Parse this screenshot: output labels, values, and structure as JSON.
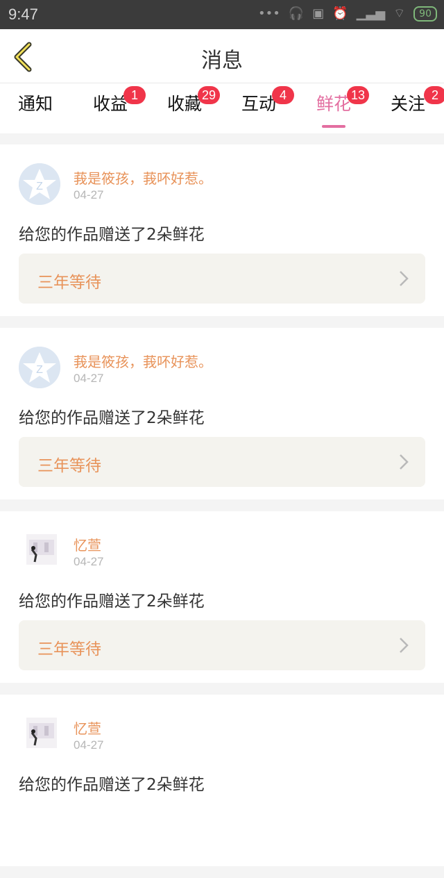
{
  "status": {
    "time": "9:47",
    "battery": "90"
  },
  "header": {
    "title": "消息"
  },
  "tabs": [
    {
      "label": "通知",
      "badge": ""
    },
    {
      "label": "收益",
      "badge": "1"
    },
    {
      "label": "收藏",
      "badge": "29"
    },
    {
      "label": "互动",
      "badge": "4"
    },
    {
      "label": "鲜花",
      "badge": "13",
      "active": true
    },
    {
      "label": "关注",
      "badge": "2"
    }
  ],
  "feed": [
    {
      "name": "莪是筱孩，莪吥好惹。",
      "date": "04-27",
      "message": "给您的作品赠送了2朵鲜花",
      "work": "三年等待",
      "avatar": "qq-default-avatar"
    },
    {
      "name": "莪是筱孩，莪吥好惹。",
      "date": "04-27",
      "message": "给您的作品赠送了2朵鲜花",
      "work": "三年等待",
      "avatar": "qq-default-avatar"
    },
    {
      "name": "忆萱",
      "date": "04-27",
      "message": "给您的作品赠送了2朵鲜花",
      "work": "三年等待",
      "avatar": "photo-avatar"
    },
    {
      "name": "忆萱",
      "date": "04-27",
      "message": "给您的作品赠送了2朵鲜花",
      "work": "",
      "avatar": "photo-avatar"
    }
  ],
  "colors": {
    "accent": "#e36ea0",
    "name": "#e8935a",
    "badge": "#f0354a"
  }
}
